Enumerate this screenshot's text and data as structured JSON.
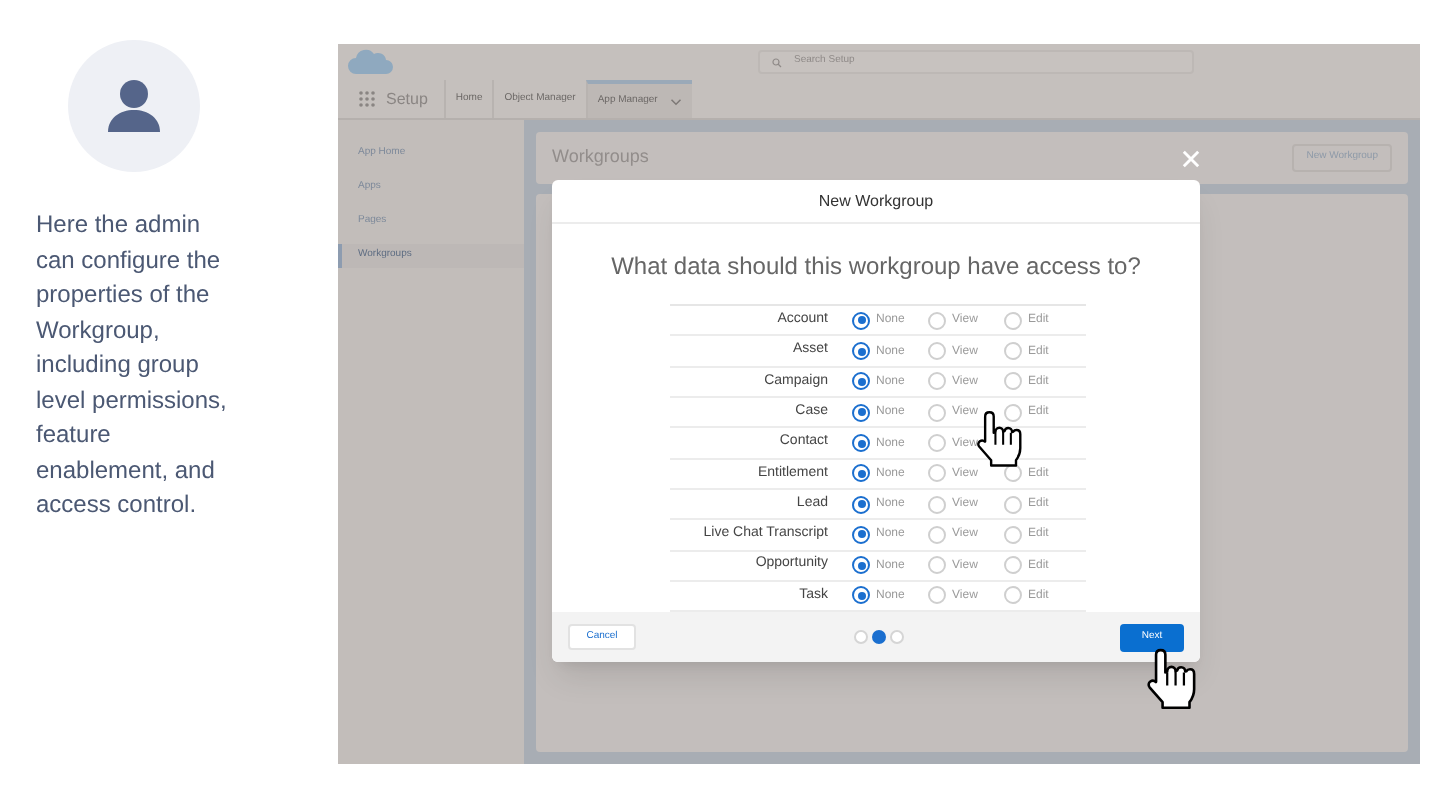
{
  "note": {
    "text": "Here the admin can configure the properties of the Workgroup, including group level permissions, feature enablement, and access control."
  },
  "header": {
    "search": {
      "placeholder": "Search Setup"
    },
    "app_name": "Setup"
  },
  "nav_tabs": [
    {
      "label": "Home",
      "selected": false
    },
    {
      "label": "Object Manager",
      "selected": false
    },
    {
      "label": "App Manager",
      "selected": true
    }
  ],
  "sidebar": {
    "items": [
      {
        "label": "App Home",
        "selected": false
      },
      {
        "label": "Apps",
        "selected": false
      },
      {
        "label": "Pages",
        "selected": false
      },
      {
        "label": "Workgroups",
        "selected": true
      }
    ]
  },
  "page": {
    "title": "Workgroups",
    "button": "New Workgroup"
  },
  "modal": {
    "title": "New Workgroup",
    "question": "What data should this workgroup have access to?",
    "rows": [
      {
        "object": "Account",
        "options": [
          {
            "label": "None",
            "selected": true
          },
          {
            "label": "View",
            "selected": false
          },
          {
            "label": "Edit",
            "selected": false
          }
        ]
      },
      {
        "object": "Asset",
        "options": [
          {
            "label": "None",
            "selected": true
          },
          {
            "label": "View",
            "selected": false
          },
          {
            "label": "Edit",
            "selected": false
          }
        ]
      },
      {
        "object": "Campaign",
        "options": [
          {
            "label": "None",
            "selected": true
          },
          {
            "label": "View",
            "selected": false
          },
          {
            "label": "Edit",
            "selected": false
          }
        ]
      },
      {
        "object": "Case",
        "options": [
          {
            "label": "None",
            "selected": true
          },
          {
            "label": "View",
            "selected": false
          },
          {
            "label": "Edit",
            "selected": false
          }
        ]
      },
      {
        "object": "Contact",
        "options": [
          {
            "label": "None",
            "selected": true
          },
          {
            "label": "View",
            "selected": false
          }
        ]
      },
      {
        "object": "Entitlement",
        "options": [
          {
            "label": "None",
            "selected": true
          },
          {
            "label": "View",
            "selected": false
          },
          {
            "label": "Edit",
            "selected": false
          }
        ]
      },
      {
        "object": "Lead",
        "options": [
          {
            "label": "None",
            "selected": true
          },
          {
            "label": "View",
            "selected": false
          },
          {
            "label": "Edit",
            "selected": false
          }
        ]
      },
      {
        "object": "Live Chat Transcript",
        "options": [
          {
            "label": "None",
            "selected": true
          },
          {
            "label": "View",
            "selected": false
          },
          {
            "label": "Edit",
            "selected": false
          }
        ]
      },
      {
        "object": "Opportunity",
        "options": [
          {
            "label": "None",
            "selected": true
          },
          {
            "label": "View",
            "selected": false
          },
          {
            "label": "Edit",
            "selected": false
          }
        ]
      },
      {
        "object": "Task",
        "options": [
          {
            "label": "None",
            "selected": true
          },
          {
            "label": "View",
            "selected": false
          },
          {
            "label": "Edit",
            "selected": false
          }
        ]
      }
    ],
    "cancel": "Cancel",
    "next": "Next",
    "steps": [
      {
        "selected": false
      },
      {
        "selected": true
      },
      {
        "selected": false
      }
    ]
  }
}
